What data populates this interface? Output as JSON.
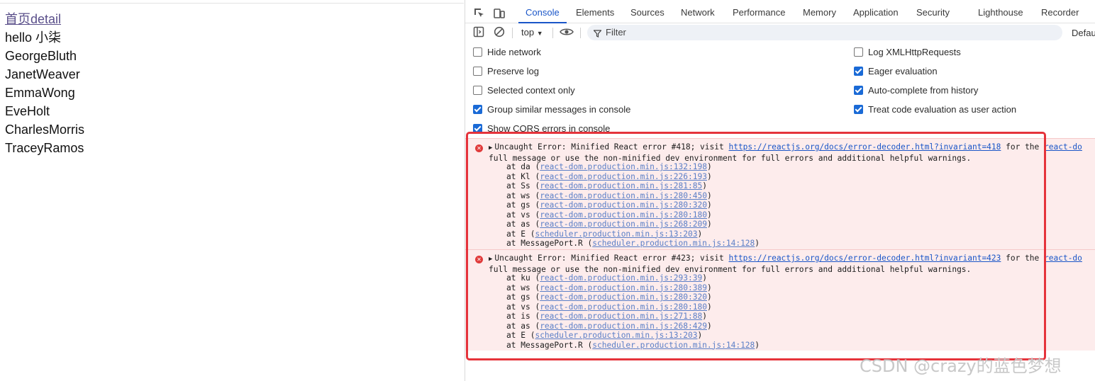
{
  "page": {
    "link": "首页detail",
    "greeting": "hello 小柒",
    "users": [
      "GeorgeBluth",
      "JanetWeaver",
      "EmmaWong",
      "EveHolt",
      "CharlesMorris",
      "TraceyRamos"
    ]
  },
  "devtools": {
    "tabs": [
      "Console",
      "Elements",
      "Sources",
      "Network",
      "Performance",
      "Memory",
      "Application",
      "Security",
      "Lighthouse",
      "Recorder"
    ],
    "active_tab": "Console",
    "context": "top",
    "filter_placeholder": "Filter",
    "default_levels": "Default",
    "settings": {
      "left": [
        {
          "label": "Hide network",
          "checked": false
        },
        {
          "label": "Preserve log",
          "checked": false
        },
        {
          "label": "Selected context only",
          "checked": false
        },
        {
          "label": "Group similar messages in console",
          "checked": true
        },
        {
          "label": "Show CORS errors in console",
          "checked": true
        }
      ],
      "right": [
        {
          "label": "Log XMLHttpRequests",
          "checked": false
        },
        {
          "label": "Eager evaluation",
          "checked": true
        },
        {
          "label": "Auto-complete from history",
          "checked": true
        },
        {
          "label": "Treat code evaluation as user action",
          "checked": true
        }
      ]
    },
    "errors": [
      {
        "prefix": "Uncaught Error: Minified React error #418; visit ",
        "url": "https://reactjs.org/docs/error-decoder.html?invariant=418",
        "suffix": " for the ",
        "tail_link": "react-do",
        "line2": "full message or use the non-minified dev environment for full errors and additional helpful warnings.",
        "frames": [
          {
            "fn": "da",
            "loc": "react-dom.production.min.js:132:198"
          },
          {
            "fn": "Kl",
            "loc": "react-dom.production.min.js:226:193"
          },
          {
            "fn": "Ss",
            "loc": "react-dom.production.min.js:281:85"
          },
          {
            "fn": "ws",
            "loc": "react-dom.production.min.js:280:450"
          },
          {
            "fn": "gs",
            "loc": "react-dom.production.min.js:280:320"
          },
          {
            "fn": "vs",
            "loc": "react-dom.production.min.js:280:180"
          },
          {
            "fn": "as",
            "loc": "react-dom.production.min.js:268:209"
          },
          {
            "fn": "E",
            "loc": "scheduler.production.min.js:13:203"
          },
          {
            "fn": "MessagePort.R",
            "loc": "scheduler.production.min.js:14:128"
          }
        ]
      },
      {
        "prefix": "Uncaught Error: Minified React error #423; visit ",
        "url": "https://reactjs.org/docs/error-decoder.html?invariant=423",
        "suffix": " for the ",
        "tail_link": "react-do",
        "line2": "full message or use the non-minified dev environment for full errors and additional helpful warnings.",
        "frames": [
          {
            "fn": "ku",
            "loc": "react-dom.production.min.js:293:39"
          },
          {
            "fn": "ws",
            "loc": "react-dom.production.min.js:280:389"
          },
          {
            "fn": "gs",
            "loc": "react-dom.production.min.js:280:320"
          },
          {
            "fn": "vs",
            "loc": "react-dom.production.min.js:280:180"
          },
          {
            "fn": "is",
            "loc": "react-dom.production.min.js:271:88"
          },
          {
            "fn": "as",
            "loc": "react-dom.production.min.js:268:429"
          },
          {
            "fn": "E",
            "loc": "scheduler.production.min.js:13:203"
          },
          {
            "fn": "MessagePort.R",
            "loc": "scheduler.production.min.js:14:128"
          }
        ]
      }
    ]
  },
  "watermark": "CSDN @crazy的蓝色梦想",
  "colors": {
    "accent": "#1a56c8",
    "error_bg": "#fdecec",
    "highlight": "#e5333b"
  }
}
